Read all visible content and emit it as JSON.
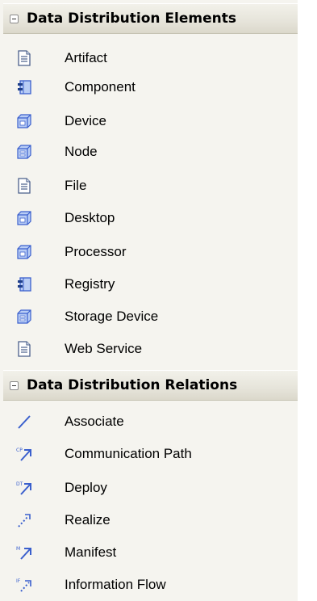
{
  "sections": [
    {
      "title": "Data Distribution Elements",
      "items": [
        {
          "label": "Artifact",
          "icon": "document-icon"
        },
        {
          "label": "Component",
          "icon": "component-icon"
        },
        {
          "label": "Device",
          "icon": "device-icon"
        },
        {
          "label": "Node",
          "icon": "node-icon"
        },
        {
          "label": "File",
          "icon": "document-icon"
        },
        {
          "label": "Desktop",
          "icon": "device-icon"
        },
        {
          "label": "Processor",
          "icon": "device-icon"
        },
        {
          "label": "Registry",
          "icon": "component-icon"
        },
        {
          "label": "Storage Device",
          "icon": "node-icon"
        },
        {
          "label": "Web Service",
          "icon": "document-icon"
        }
      ]
    },
    {
      "title": "Data Distribution Relations",
      "items": [
        {
          "label": "Associate",
          "icon": "associate-line-icon"
        },
        {
          "label": "Communication Path",
          "icon": "communication-path-icon",
          "icon_text": "CP"
        },
        {
          "label": "Deploy",
          "icon": "deploy-icon",
          "icon_text": "DT"
        },
        {
          "label": "Realize",
          "icon": "realize-icon"
        },
        {
          "label": "Manifest",
          "icon": "manifest-icon",
          "icon_text": "M"
        },
        {
          "label": "Information Flow",
          "icon": "information-flow-icon",
          "icon_text": "IF"
        }
      ]
    }
  ],
  "colors": {
    "panel_bg": "#f5f4ef",
    "header_gradient_top": "#f2f1ea",
    "header_gradient_bottom": "#dbd8cb",
    "icon_blue": "#3a5fcd",
    "icon_light_blue": "#b9cdf5"
  }
}
